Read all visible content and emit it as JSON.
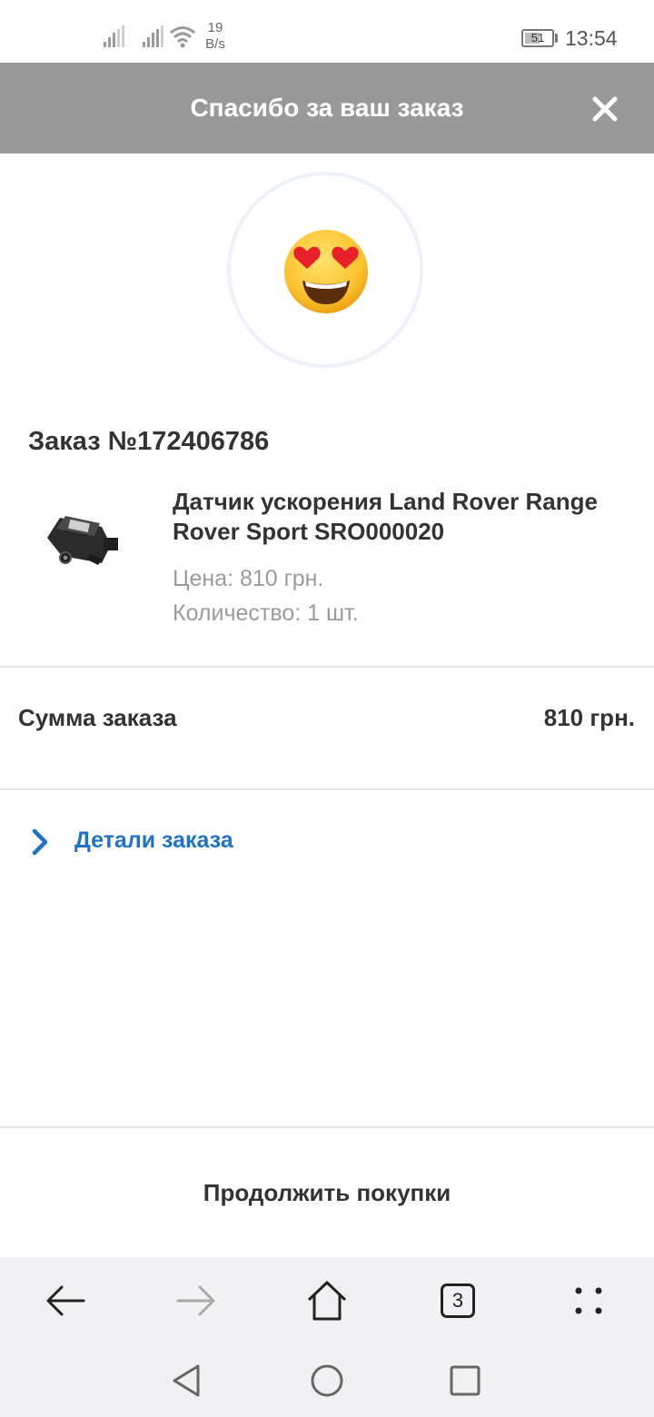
{
  "status_bar": {
    "net_speed_value": "19",
    "net_speed_unit": "B/s",
    "battery_level": "51",
    "time": "13:54"
  },
  "header": {
    "title": "Спасибо за ваш заказ",
    "close_icon": "close-icon"
  },
  "emoji": "heart-eyes-emoji",
  "order": {
    "number": "Заказ №172406786",
    "product": {
      "name": "Датчик ускорения Land Rover Range Rover Sport SRO000020",
      "price": "Цена: 810 грн.",
      "quantity": "Количество: 1 шт.",
      "image": "acceleration-sensor-image"
    },
    "sum_label": "Сумма заказа",
    "sum_value": "810 грн.",
    "details_label": "Детали заказа"
  },
  "continue_label": "Продолжить покупки",
  "browser_bar": {
    "tabs_count": "3",
    "icons": [
      "back-arrow-icon",
      "forward-arrow-icon",
      "home-icon",
      "tabs-icon",
      "more-icon"
    ]
  },
  "system_nav": {
    "icons": [
      "back-triangle-icon",
      "home-circle-icon",
      "recents-square-icon"
    ]
  },
  "colors": {
    "header_bg": "#999999",
    "link": "#1e73c8",
    "muted_text": "#9b9b9b",
    "toolbar_bg": "#f1f1f3"
  }
}
